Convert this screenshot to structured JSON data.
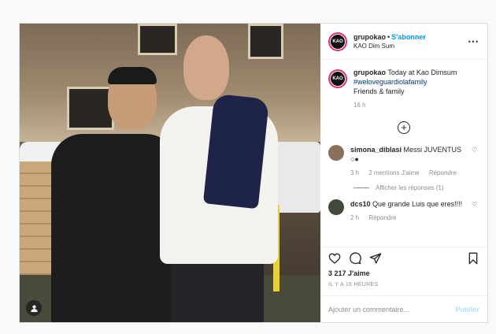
{
  "post": {
    "username": "grupokao",
    "follow_label": "S'abonner",
    "location": "KAO Dim Sum",
    "avatar_text": "KAO",
    "more_icon": "⋯",
    "caption": {
      "username": "grupokao",
      "text": "Today at Kao Dimsum",
      "hashtag": "#weloveguardiolafamily",
      "line2": "Friends & family",
      "age": "16 h"
    },
    "load_more_icon": "+",
    "comments": [
      {
        "username": "simona_diblasi",
        "text": "Messi JUVENTUS",
        "emoji": "○●",
        "age": "3 h",
        "likes": "2 mentions J'aime",
        "reply": "Répondre",
        "avatar_color": "#8a6f5a"
      },
      {
        "username": "dcs10",
        "text": "Que grande Luis que eres!!!!",
        "age": "2 h",
        "reply": "Répondre",
        "avatar_color": "#3f4a3a"
      }
    ],
    "view_replies": "Afficher les réponses (1)",
    "like_count": "3 217 J'aime",
    "timestamp": "IL Y A 16 HEURES",
    "comment_placeholder": "Ajouter un commentaire...",
    "publish_label": "Publier",
    "heart_icon": "♡"
  }
}
